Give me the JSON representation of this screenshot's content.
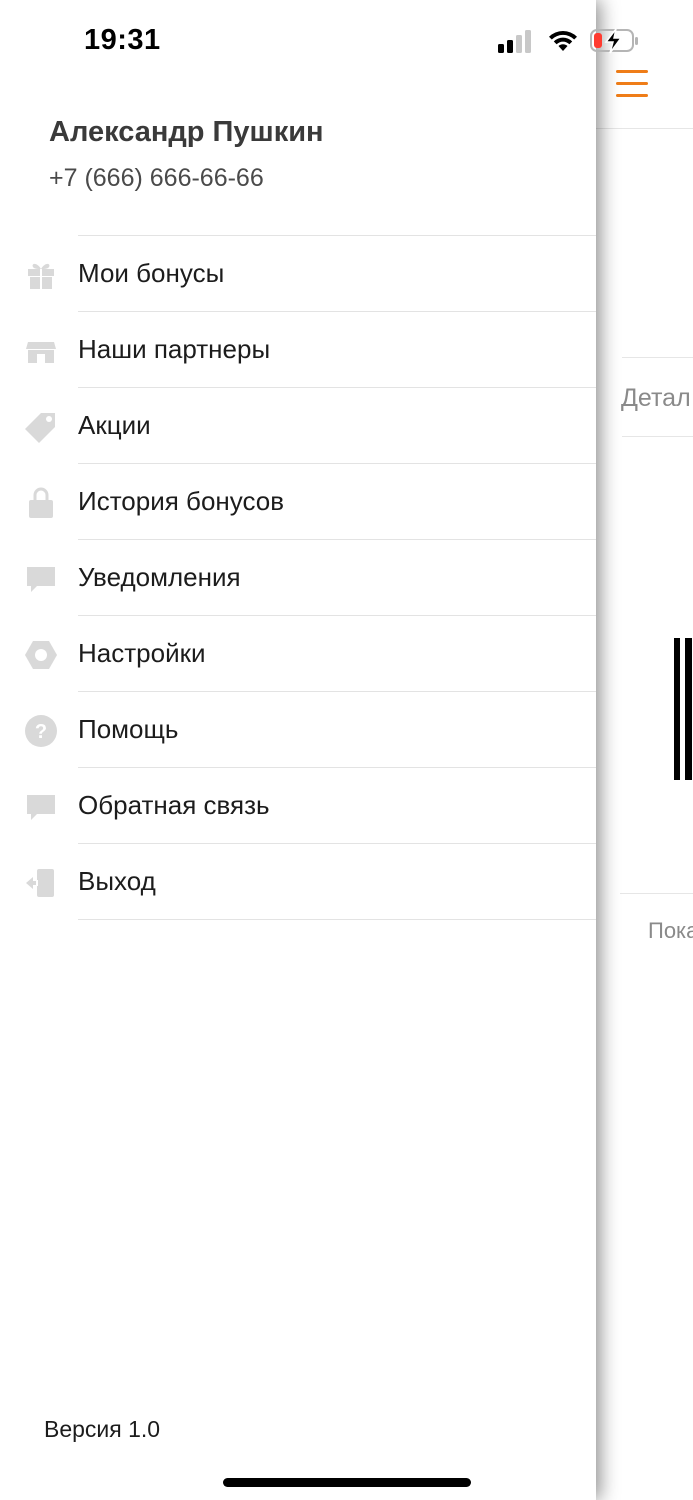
{
  "status_bar": {
    "time": "19:31"
  },
  "profile": {
    "name": "Александр Пушкин",
    "phone": "+7 (666) 666-66-66"
  },
  "menu": {
    "items": [
      {
        "label": "Мои бонусы",
        "icon": "gift-icon"
      },
      {
        "label": "Наши партнеры",
        "icon": "store-icon"
      },
      {
        "label": "Акции",
        "icon": "tag-icon"
      },
      {
        "label": "История бонусов",
        "icon": "shopping-bag-icon"
      },
      {
        "label": "Уведомления",
        "icon": "chat-bubble-icon"
      },
      {
        "label": "Настройки",
        "icon": "settings-hexagon-icon"
      },
      {
        "label": "Помощь",
        "icon": "help-circle-icon"
      },
      {
        "label": "Обратная связь",
        "icon": "feedback-bubble-icon"
      },
      {
        "label": "Выход",
        "icon": "logout-icon"
      }
    ]
  },
  "footer": {
    "version": "Версия 1.0"
  },
  "background_screen": {
    "details_label": "Детал",
    "show_label": "Пока"
  },
  "colors": {
    "accent": "#ef7d18",
    "icon_gray": "#d9d9d9",
    "divider": "#e3e3e3",
    "battery_low": "#ff3b30"
  }
}
